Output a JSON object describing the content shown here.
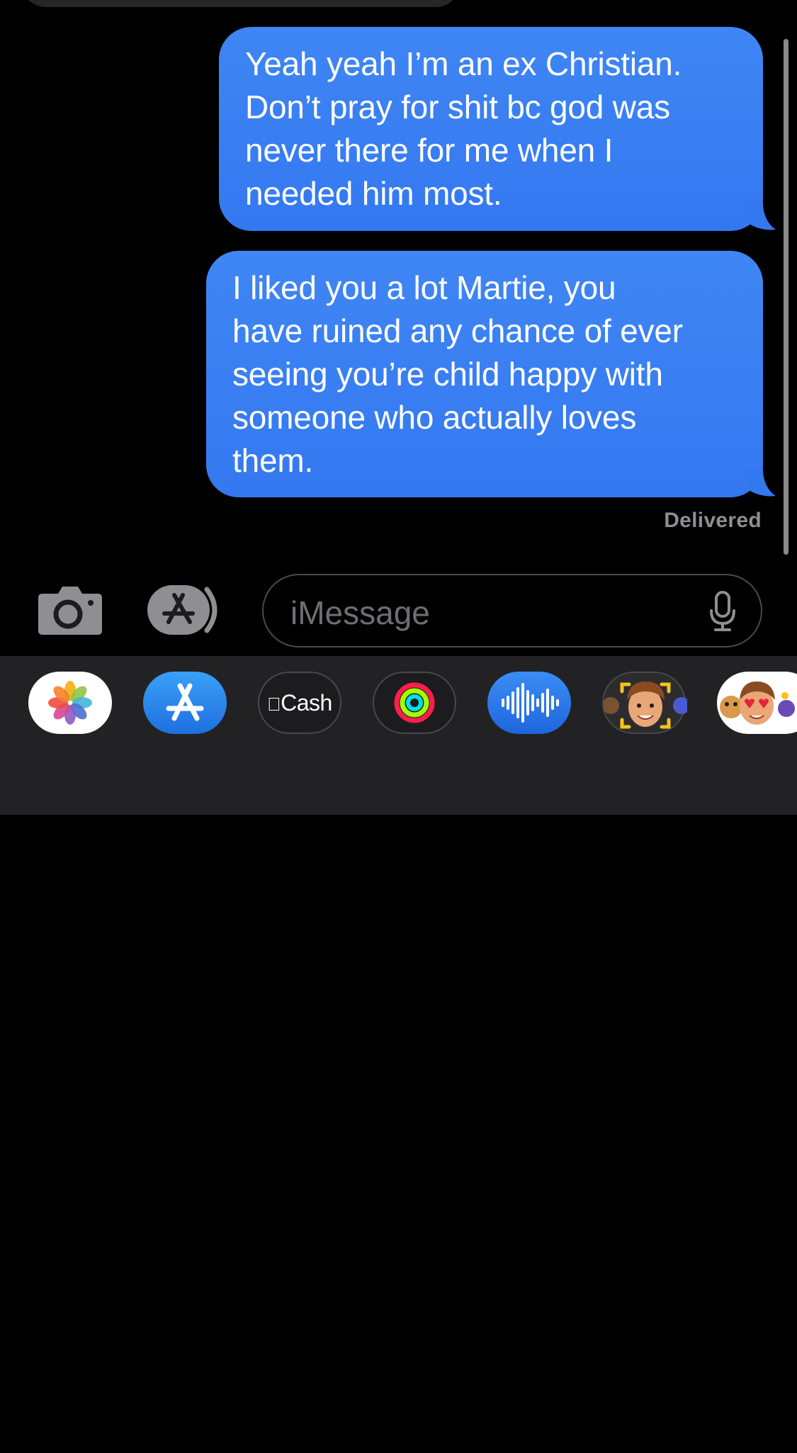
{
  "conversation": {
    "messages": [
      {
        "sender": "me",
        "text": "Yeah yeah I’m an ex Christian.\nDon’t pray for shit bc god was\nnever there for me when I\nneeded him most."
      },
      {
        "sender": "me",
        "text": "I liked you a lot Martie, you\nhave ruined any chance of ever\nseeing you’re child happy with\nsomeone who actually loves\nthem."
      }
    ],
    "status": "Delivered"
  },
  "input_bar": {
    "placeholder": "iMessage",
    "camera_icon": "camera-icon",
    "apps_icon": "app-store-icon",
    "mic_icon": "microphone-icon"
  },
  "app_drawer": {
    "apps": [
      {
        "name": "Photos",
        "icon": "photos-icon"
      },
      {
        "name": "App Store",
        "icon": "app-store-icon"
      },
      {
        "name": "Apple Cash",
        "icon": "apple-logo",
        "label": "Cash"
      },
      {
        "name": "Activity",
        "icon": "activity-rings-icon"
      },
      {
        "name": "Audio Message",
        "icon": "waveform-icon"
      },
      {
        "name": "Memoji",
        "icon": "memoji-icon"
      },
      {
        "name": "Memoji Stickers",
        "icon": "memoji-stickers-icon"
      }
    ]
  },
  "colors": {
    "background": "#000000",
    "bubble_blue": "#3b82f0",
    "delivered_gray": "#8e8e93",
    "drawer": "#222224",
    "placeholder_gray": "#6e6e73"
  }
}
